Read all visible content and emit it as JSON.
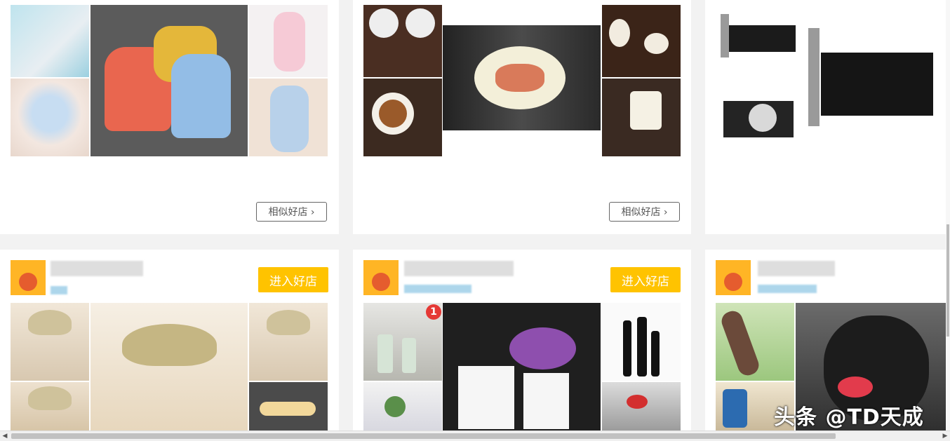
{
  "shops_top": [
    {
      "similar_label": "相似好店 ›"
    },
    {
      "similar_label": "相似好店 ›"
    }
  ],
  "shops_bottom": [
    {
      "enter_label": "进入好店"
    },
    {
      "enter_label": "进入好店"
    }
  ],
  "badge_count": "1",
  "watermark": "头条 @TD天成",
  "scrollbar": {
    "left_arrow": "◀",
    "right_arrow": "▶"
  }
}
